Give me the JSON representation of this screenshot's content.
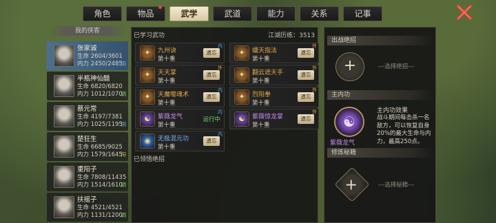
{
  "tabs": [
    {
      "label": "角色",
      "active": false,
      "dot": false
    },
    {
      "label": "物品",
      "active": false,
      "dot": true
    },
    {
      "label": "武学",
      "active": true,
      "dot": false
    },
    {
      "label": "武道",
      "active": false,
      "dot": false
    },
    {
      "label": "能力",
      "active": false,
      "dot": false
    },
    {
      "label": "关系",
      "active": false,
      "dot": false
    },
    {
      "label": "记事",
      "active": false,
      "dot": false
    }
  ],
  "heroes_header": "我的侠客",
  "heroes": [
    {
      "name": "张家诚",
      "line1": "生命 2604/3601",
      "line2": "内力 2450/2485",
      "tag": "阴",
      "tag_color": "#6fb0e8",
      "selected": true
    },
    {
      "name": "半瓶神仙醋",
      "line1": "生命 6820/6820",
      "line2": "内力 1012/1070",
      "tag": "调",
      "tag_color": "#7fcf6a",
      "selected": false
    },
    {
      "name": "蔡元常",
      "line1": "生命 4197/7381",
      "line2": "内力 1025/1195",
      "tag": "阴",
      "tag_color": "#6fb0e8",
      "selected": false
    },
    {
      "name": "楚狂生",
      "line1": "生命 6685/9025",
      "line2": "内力 1579/1645",
      "tag": "阳",
      "tag_color": "#d9b05a",
      "selected": false
    },
    {
      "name": "重阳子",
      "line1": "生命 7808/11435",
      "line2": "内力 1514/1610",
      "tag": "调",
      "tag_color": "#7fcf6a",
      "selected": false
    },
    {
      "name": "扶摇子",
      "line1": "生命 4521/4521",
      "line2": "内力 1131/1200",
      "tag": "调",
      "tag_color": "#7fcf6a",
      "selected": false
    }
  ],
  "learned_label": "已学习武功",
  "jianghu": "江湖历练：3513",
  "comprehend_label": "已领悟绝招",
  "skills": [
    {
      "name": "九州诀",
      "level": "第十重",
      "action": "遗忘",
      "type": "内",
      "color": "orange"
    },
    {
      "name": "天天掌",
      "level": "第十重",
      "action": "遗忘",
      "type": "外",
      "color": "orange"
    },
    {
      "name": "天魔噬魂术",
      "level": "第十重",
      "action": "遗忘",
      "type": "内",
      "color": "orange"
    },
    {
      "name": "紫薇龙气",
      "level": "第十重",
      "action": "运行中",
      "type": "内",
      "color": "purple"
    },
    {
      "name": "无极混元功",
      "level": "第十重",
      "action": "遗忘",
      "type": "内",
      "color": "blue"
    },
    {
      "name": "蟠天指法",
      "level": "第十重",
      "action": "遗忘",
      "type": "外",
      "color": "orange"
    },
    {
      "name": "翻云遮天手",
      "level": "第十重",
      "action": "遗忘",
      "type": "外",
      "color": "orange"
    },
    {
      "name": "烈阳拳",
      "level": "第十重",
      "action": "遗忘",
      "type": "外",
      "color": "orange"
    },
    {
      "name": "紫薇惊龙掌",
      "level": "第十重",
      "action": "遗忘",
      "type": "外",
      "color": "purple"
    }
  ],
  "right": {
    "battle_header": "出战绝招",
    "battle_hint": "选择绝招",
    "main_header": "主内功",
    "effect_title": "主内功效果",
    "effect_text": "战斗期间每击杀一名敌方，可以恢复自身20%的最大生命与内力，最高250点。",
    "main_art": "紫薇龙气",
    "secret_header": "修炼秘籍",
    "secret_hint": "选择秘籍"
  }
}
